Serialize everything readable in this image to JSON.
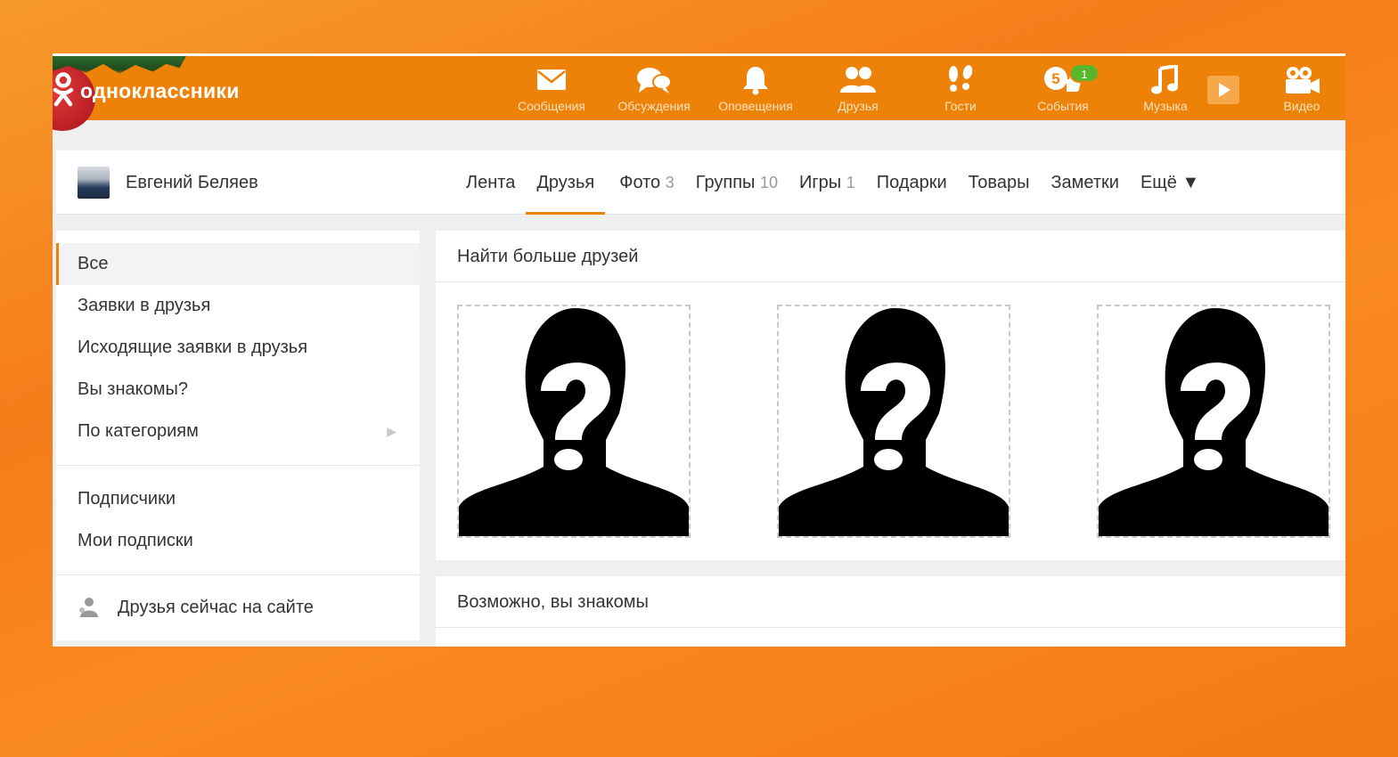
{
  "brand": {
    "name": "одноклассники"
  },
  "topnav": [
    {
      "label": "Сообщения",
      "icon": "envelope-icon"
    },
    {
      "label": "Обсуждения",
      "icon": "chat-bubbles-icon"
    },
    {
      "label": "Оповещения",
      "icon": "bell-icon"
    },
    {
      "label": "Друзья",
      "icon": "friends-icon"
    },
    {
      "label": "Гости",
      "icon": "footprints-icon"
    },
    {
      "label": "События",
      "icon": "events-icon",
      "events_count": "5",
      "badge": "1"
    },
    {
      "label": "Музыка",
      "icon": "music-note-icon"
    },
    {
      "label": "Видео",
      "icon": "video-camera-icon"
    }
  ],
  "profile": {
    "name": "Евгений Беляев",
    "tabs": [
      {
        "label": "Лента",
        "count": ""
      },
      {
        "label": "Друзья",
        "count": "",
        "active": true
      },
      {
        "label": "Фото",
        "count": "3"
      },
      {
        "label": "Группы",
        "count": "10"
      },
      {
        "label": "Игры",
        "count": "1"
      },
      {
        "label": "Подарки",
        "count": ""
      },
      {
        "label": "Товары",
        "count": ""
      },
      {
        "label": "Заметки",
        "count": ""
      },
      {
        "label": "Ещё ▼",
        "count": ""
      }
    ]
  },
  "sidebar": {
    "group1": [
      "Все",
      "Заявки в друзья",
      "Исходящие заявки в друзья",
      "Вы знакомы?",
      "По категориям"
    ],
    "group2": [
      "Подписчики",
      "Мои подписки"
    ],
    "online": "Друзья сейчас на сайте"
  },
  "main": {
    "find_title": "Найти больше друзей",
    "maybe_title": "Возможно, вы знакомы"
  },
  "colors": {
    "accent": "#ee8208",
    "badge": "#5ab52c"
  }
}
